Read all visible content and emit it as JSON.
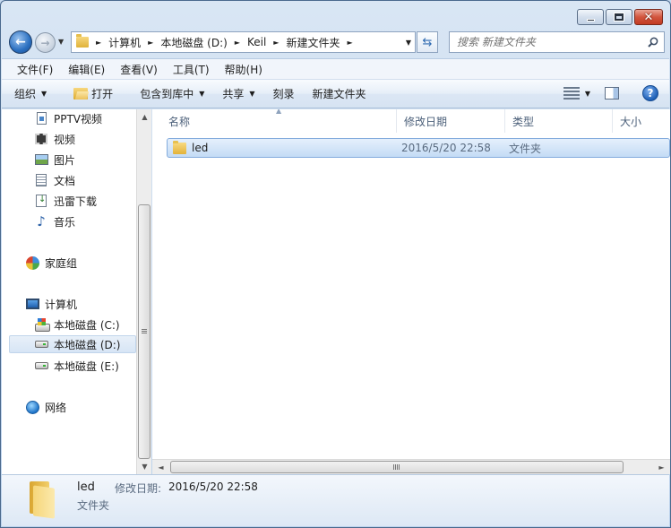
{
  "window": {
    "caption": {
      "minimize": "",
      "maximize": "",
      "close": "✕"
    }
  },
  "nav": {
    "breadcrumb": [
      "计算机",
      "本地磁盘 (D:)",
      "Keil",
      "新建文件夹"
    ],
    "search_placeholder": "搜索 新建文件夹"
  },
  "menubar": {
    "items": [
      "文件(F)",
      "编辑(E)",
      "查看(V)",
      "工具(T)",
      "帮助(H)"
    ]
  },
  "toolbar": {
    "organize": "组织",
    "open": "打开",
    "include_library": "包含到库中",
    "share": "共享",
    "burn": "刻录",
    "new_folder": "新建文件夹",
    "help": "?"
  },
  "sidebar": {
    "items": [
      {
        "label": "PPTV视频",
        "icon": "document-icon"
      },
      {
        "label": "视频",
        "icon": "video-icon"
      },
      {
        "label": "图片",
        "icon": "picture-icon"
      },
      {
        "label": "文档",
        "icon": "text-document-icon"
      },
      {
        "label": "迅雷下载",
        "icon": "download-icon"
      },
      {
        "label": "音乐",
        "icon": "music-icon"
      },
      {
        "label": "家庭组",
        "icon": "homegroup-icon"
      },
      {
        "label": "计算机",
        "icon": "computer-icon"
      },
      {
        "label": "本地磁盘 (C:)",
        "icon": "system-drive-icon"
      },
      {
        "label": "本地磁盘 (D:)",
        "icon": "drive-icon",
        "selected": true
      },
      {
        "label": "本地磁盘 (E:)",
        "icon": "drive-icon"
      },
      {
        "label": "网络",
        "icon": "network-icon"
      }
    ]
  },
  "filelist": {
    "columns": [
      "名称",
      "修改日期",
      "类型",
      "大小"
    ],
    "rows": [
      {
        "name": "led",
        "modified": "2016/5/20 22:58",
        "type": "文件夹",
        "size": ""
      }
    ]
  },
  "details": {
    "name": "led",
    "type": "文件夹",
    "modified_label": "修改日期:",
    "modified_value": "2016/5/20 22:58"
  },
  "colors": {
    "selection": "#c4dcf5",
    "header_text": "#4c607a",
    "frame": "#c5d8ee"
  }
}
